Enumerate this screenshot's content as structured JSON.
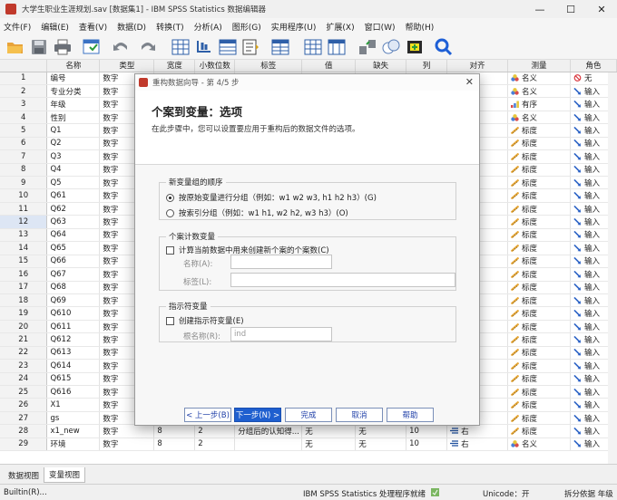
{
  "window": {
    "title": "大学生职业生涯规划.sav [数据集1] - IBM SPSS Statistics 数据编辑器",
    "minimize": "—",
    "maximize": "☐",
    "close": "✕"
  },
  "menu": [
    "文件(F)",
    "编辑(E)",
    "查看(V)",
    "数据(D)",
    "转换(T)",
    "分析(A)",
    "图形(G)",
    "实用程序(U)",
    "扩展(X)",
    "窗口(W)",
    "帮助(H)"
  ],
  "columns": [
    "",
    "名称",
    "类型",
    "宽度",
    "小数位数",
    "标签",
    "值",
    "缺失",
    "列",
    "对齐",
    "测量",
    "角色"
  ],
  "rows": [
    {
      "n": "1",
      "name": "编号",
      "type": "数字",
      "measure": "名义",
      "mcolor": "nominal",
      "role": "无",
      "rcolor": "none"
    },
    {
      "n": "2",
      "name": "专业分类",
      "type": "数字",
      "measure": "名义",
      "mcolor": "nominal",
      "role": "输入",
      "rcolor": "input"
    },
    {
      "n": "3",
      "name": "年级",
      "type": "数字",
      "measure": "有序",
      "mcolor": "ordinal",
      "role": "输入",
      "rcolor": "input"
    },
    {
      "n": "4",
      "name": "性别",
      "type": "数字",
      "measure": "名义",
      "mcolor": "nominal",
      "role": "输入",
      "rcolor": "input"
    },
    {
      "n": "5",
      "name": "Q1",
      "type": "数字",
      "measure": "标度",
      "mcolor": "scale",
      "role": "输入",
      "rcolor": "input"
    },
    {
      "n": "6",
      "name": "Q2",
      "type": "数字",
      "measure": "标度",
      "mcolor": "scale",
      "role": "输入",
      "rcolor": "input"
    },
    {
      "n": "7",
      "name": "Q3",
      "type": "数字",
      "measure": "标度",
      "mcolor": "scale",
      "role": "输入",
      "rcolor": "input"
    },
    {
      "n": "8",
      "name": "Q4",
      "type": "数字",
      "measure": "标度",
      "mcolor": "scale",
      "role": "输入",
      "rcolor": "input"
    },
    {
      "n": "9",
      "name": "Q5",
      "type": "数字",
      "measure": "标度",
      "mcolor": "scale",
      "role": "输入",
      "rcolor": "input"
    },
    {
      "n": "10",
      "name": "Q61",
      "type": "数字",
      "measure": "标度",
      "mcolor": "scale",
      "role": "输入",
      "rcolor": "input"
    },
    {
      "n": "11",
      "name": "Q62",
      "type": "数字",
      "measure": "标度",
      "mcolor": "scale",
      "role": "输入",
      "rcolor": "input"
    },
    {
      "n": "12",
      "name": "Q63",
      "type": "数字",
      "measure": "标度",
      "mcolor": "scale",
      "role": "输入",
      "rcolor": "input"
    },
    {
      "n": "13",
      "name": "Q64",
      "type": "数字",
      "measure": "标度",
      "mcolor": "scale",
      "role": "输入",
      "rcolor": "input"
    },
    {
      "n": "14",
      "name": "Q65",
      "type": "数字",
      "measure": "标度",
      "mcolor": "scale",
      "role": "输入",
      "rcolor": "input"
    },
    {
      "n": "15",
      "name": "Q66",
      "type": "数字",
      "measure": "标度",
      "mcolor": "scale",
      "role": "输入",
      "rcolor": "input"
    },
    {
      "n": "16",
      "name": "Q67",
      "type": "数字",
      "measure": "标度",
      "mcolor": "scale",
      "role": "输入",
      "rcolor": "input"
    },
    {
      "n": "17",
      "name": "Q68",
      "type": "数字",
      "measure": "标度",
      "mcolor": "scale",
      "role": "输入",
      "rcolor": "input"
    },
    {
      "n": "18",
      "name": "Q69",
      "type": "数字",
      "measure": "标度",
      "mcolor": "scale",
      "role": "输入",
      "rcolor": "input"
    },
    {
      "n": "19",
      "name": "Q610",
      "type": "数字",
      "measure": "标度",
      "mcolor": "scale",
      "role": "输入",
      "rcolor": "input"
    },
    {
      "n": "20",
      "name": "Q611",
      "type": "数字",
      "measure": "标度",
      "mcolor": "scale",
      "role": "输入",
      "rcolor": "input"
    },
    {
      "n": "21",
      "name": "Q612",
      "type": "数字",
      "measure": "标度",
      "mcolor": "scale",
      "role": "输入",
      "rcolor": "input"
    },
    {
      "n": "22",
      "name": "Q613",
      "type": "数字",
      "measure": "标度",
      "mcolor": "scale",
      "role": "输入",
      "rcolor": "input"
    },
    {
      "n": "23",
      "name": "Q614",
      "type": "数字",
      "measure": "标度",
      "mcolor": "scale",
      "role": "输入",
      "rcolor": "input"
    },
    {
      "n": "24",
      "name": "Q615",
      "type": "数字",
      "measure": "标度",
      "mcolor": "scale",
      "role": "输入",
      "rcolor": "input"
    },
    {
      "n": "25",
      "name": "Q616",
      "type": "数字",
      "measure": "标度",
      "mcolor": "scale",
      "role": "输入",
      "rcolor": "input"
    },
    {
      "n": "26",
      "name": "X1",
      "type": "数字",
      "measure": "标度",
      "mcolor": "scale",
      "role": "输入",
      "rcolor": "input"
    },
    {
      "n": "27",
      "name": "gs",
      "type": "数字",
      "measure": "标度",
      "mcolor": "scale",
      "role": "输入",
      "rcolor": "input"
    },
    {
      "n": "28",
      "name": "x1_new",
      "type": "数字",
      "width": "8",
      "decimals": "2",
      "label": "分组后的认知得...",
      "values": "无",
      "missing": "无",
      "cols": "10",
      "align": "右",
      "measure": "标度",
      "mcolor": "scale",
      "role": "输入",
      "rcolor": "input"
    },
    {
      "n": "29",
      "name": "环境",
      "type": "数字",
      "width": "8",
      "decimals": "2",
      "label": "",
      "values": "无",
      "missing": "无",
      "cols": "10",
      "align": "右",
      "measure": "名义",
      "mcolor": "nominal",
      "role": "输入",
      "rcolor": "input"
    }
  ],
  "tabs": {
    "data_view": "数据视图",
    "variable_view": "变量视图"
  },
  "status": {
    "menu": "Builtin(R)...",
    "processor": "IBM SPSS Statistics 处理程序就绪",
    "unicode": "Unicode：开",
    "split": "拆分依据 年级"
  },
  "dialog": {
    "title": "重构数据向导 - 第 4/5 步",
    "close": "✕",
    "heading": "个案到变量：选项",
    "subheading": "在此步骤中，您可以设置要应用于重构后的数据文件的选项。",
    "group1": {
      "legend": "新变量组的顺序",
      "opt1": "按原始变量进行分组（例如：w1 w2 w3, h1 h2 h3）(G)",
      "opt2": "按索引分组（例如：w1 h1, w2 h2, w3 h3）(O)"
    },
    "group2": {
      "legend": "个案计数变量",
      "check": "计算当前数据中用来创建新个案的个案数(C)",
      "name_label": "名称(A):",
      "label_label": "标签(L):"
    },
    "group3": {
      "legend": "指示符变量",
      "check": "创建指示符变量(E)",
      "root_label": "根名称(R):",
      "root_value": "ind"
    },
    "buttons": {
      "back": "< 上一步(B)",
      "next": "下一步(N) >",
      "finish": "完成",
      "cancel": "取消",
      "help": "帮助"
    }
  }
}
